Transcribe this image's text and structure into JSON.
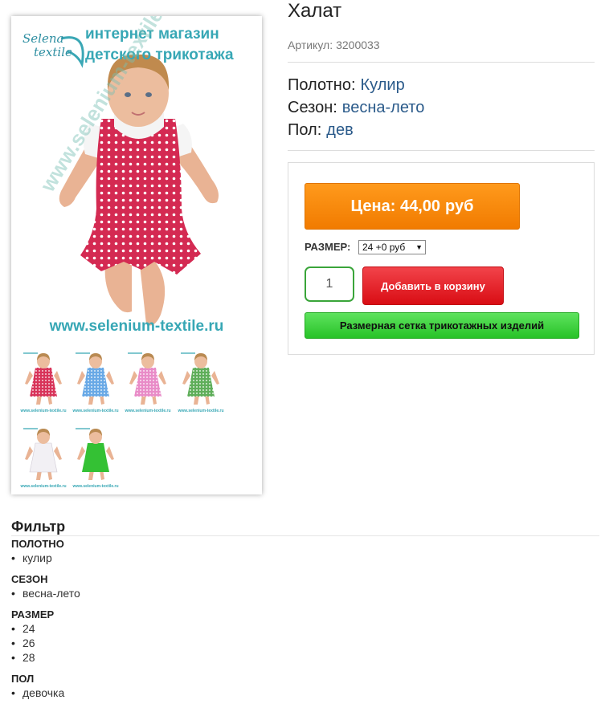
{
  "product": {
    "title": "Халат",
    "sku_label": "Артикул:",
    "sku_value": "3200033",
    "properties": [
      {
        "label": "Полотно:",
        "value": "Кулир"
      },
      {
        "label": "Сезон:",
        "value": "весна-лето"
      },
      {
        "label": "Пол:",
        "value": "дев"
      }
    ]
  },
  "image": {
    "logo_line1": "Selena",
    "logo_line2": "textile",
    "shop_line1": "интернет магазин",
    "shop_line2": "детского трикотажа",
    "watermark": "www.selenium-textile.ru",
    "site_url": "www.selenium-textile.ru",
    "thumb_url": "www.selenium-textile.ru",
    "thumbnails": [
      {
        "dress_color": "#d8345a",
        "pattern": "dots"
      },
      {
        "dress_color": "#69a9e6",
        "pattern": "dots"
      },
      {
        "dress_color": "#e98cc8",
        "pattern": "dots"
      },
      {
        "dress_color": "#5fae5a",
        "pattern": "print"
      },
      {
        "dress_color": "#f2f0f4",
        "pattern": "plain"
      },
      {
        "dress_color": "#34c134",
        "pattern": "plain"
      }
    ]
  },
  "buy": {
    "price_label": "Цена: 44,00",
    "price_currency": "руб",
    "size_label": "РАЗМЕР:",
    "size_selected": "24 +0 руб",
    "quantity": "1",
    "cart_button": "Добавить в корзину",
    "size_chart_button": "Размерная сетка трикотажных изделий"
  },
  "filter": {
    "title": "Фильтр",
    "groups": [
      {
        "heading": "ПОЛОТНО",
        "items": [
          "кулир"
        ]
      },
      {
        "heading": "СЕЗОН",
        "items": [
          "весна-лето"
        ]
      },
      {
        "heading": "РАЗМЕР",
        "items": [
          "24",
          "26",
          "28"
        ]
      },
      {
        "heading": "ПОЛ",
        "items": [
          "девочка"
        ]
      }
    ]
  },
  "colors": {
    "price_orange": "#f58a0b",
    "cart_red": "#e1151c",
    "size_chart_green": "#3fd33f",
    "link_blue": "#2a5a8a"
  }
}
